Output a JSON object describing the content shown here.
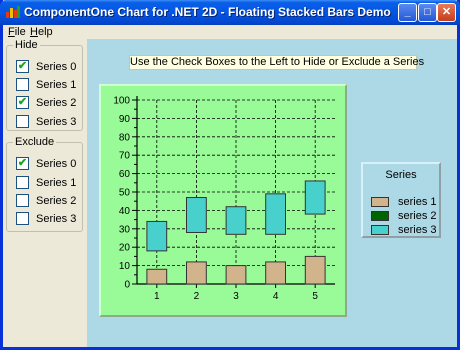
{
  "window": {
    "title": "ComponentOne Chart for .NET 2D - Floating Stacked Bars Demo",
    "controls": {
      "minimize": "_",
      "maximize": "□",
      "close": "✕"
    }
  },
  "menu": {
    "file": {
      "accel": "F",
      "rest": "ile"
    },
    "help": {
      "accel": "H",
      "rest": "elp"
    }
  },
  "hide_group": {
    "title": "Hide",
    "items": [
      {
        "label": "Series 0",
        "checked": true,
        "mark": "✔"
      },
      {
        "label": "Series 1",
        "checked": false,
        "mark": ""
      },
      {
        "label": "Series 2",
        "checked": true,
        "mark": "✔"
      },
      {
        "label": "Series 3",
        "checked": false,
        "mark": ""
      }
    ]
  },
  "exclude_group": {
    "title": "Exclude",
    "items": [
      {
        "label": "Series 0",
        "checked": true,
        "mark": "✔"
      },
      {
        "label": "Series 1",
        "checked": false,
        "mark": ""
      },
      {
        "label": "Series 2",
        "checked": false,
        "mark": ""
      },
      {
        "label": "Series 3",
        "checked": false,
        "mark": ""
      }
    ]
  },
  "banner": "Use the Check Boxes to the Left to Hide or Exclude a Series",
  "legend": {
    "title": "Series",
    "items": [
      {
        "label": "series 1",
        "color": "#d2b48c"
      },
      {
        "label": "series 2",
        "color": "#006400"
      },
      {
        "label": "series 3",
        "color": "#48d1cc"
      }
    ]
  },
  "chart_data": {
    "type": "bar",
    "subtype": "floating-stacked",
    "x": [
      1,
      2,
      3,
      4,
      5
    ],
    "xticks": [
      "1",
      "2",
      "3",
      "4",
      "5"
    ],
    "yticks": [
      "0",
      "10",
      "20",
      "30",
      "40",
      "50",
      "60",
      "70",
      "80",
      "90",
      "100"
    ],
    "ylim": [
      0,
      100
    ],
    "grid": true,
    "plot_background": "#98fb98",
    "series": [
      {
        "name": "series 1",
        "color": "#d2b48c",
        "low": [
          0,
          0,
          0,
          0,
          0
        ],
        "high": [
          8,
          12,
          10,
          12,
          15
        ]
      },
      {
        "name": "series 3",
        "color": "#48d1cc",
        "low": [
          18,
          28,
          27,
          27,
          38
        ],
        "high": [
          34,
          47,
          42,
          49,
          56
        ]
      }
    ]
  }
}
